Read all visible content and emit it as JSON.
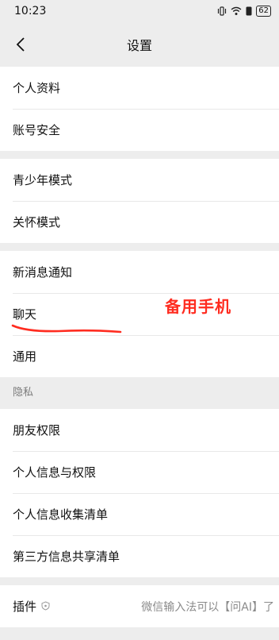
{
  "status_bar": {
    "time": "10:23",
    "battery": "62"
  },
  "header": {
    "title": "设置"
  },
  "groups": [
    {
      "items": [
        "个人资料",
        "账号安全"
      ]
    },
    {
      "items": [
        "青少年模式",
        "关怀模式"
      ]
    },
    {
      "items": [
        "新消息通知",
        "聊天",
        "通用"
      ]
    }
  ],
  "privacy": {
    "section_label": "隐私",
    "items": [
      "朋友权限",
      "个人信息与权限",
      "个人信息收集清单",
      "第三方信息共享清单"
    ]
  },
  "plugin": {
    "label": "插件",
    "value": "微信输入法可以【问AI】了"
  },
  "annotation": {
    "text": "备用手机",
    "color": "#ff2c20"
  },
  "icons": [
    "back-chevron-icon",
    "signal-icon",
    "wifi-icon",
    "shield-icon"
  ]
}
